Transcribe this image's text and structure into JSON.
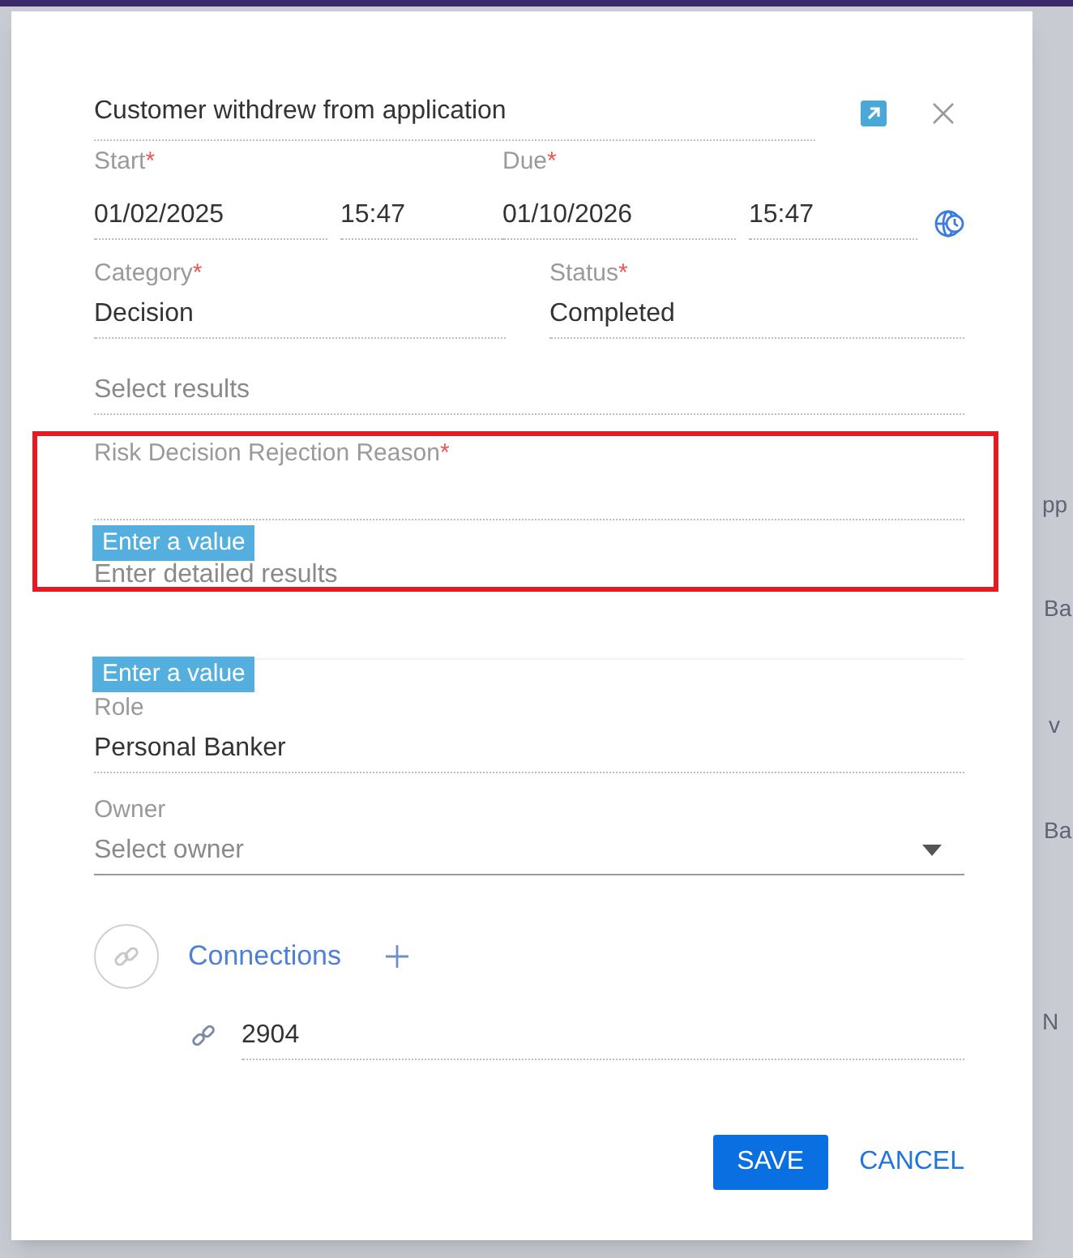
{
  "background": {
    "fragments": [
      "pp",
      "Ba",
      "v",
      "Ba",
      "N"
    ]
  },
  "title_field": {
    "value": "Customer withdrew from application"
  },
  "start": {
    "label": "Start",
    "required_mark": "*",
    "date": "01/02/2025",
    "time": "15:47"
  },
  "due": {
    "label": "Due",
    "required_mark": "*",
    "date": "01/10/2026",
    "time": "15:47"
  },
  "category": {
    "label": "Category",
    "required_mark": "*",
    "value": "Decision"
  },
  "status": {
    "label": "Status",
    "required_mark": "*",
    "value": "Completed"
  },
  "results": {
    "placeholder": "Select results"
  },
  "rejection_reason": {
    "label": "Risk Decision Rejection Reason",
    "required_mark": "*",
    "validation_message": "Enter a value"
  },
  "detailed_results": {
    "placeholder": "Enter detailed results",
    "validation_message": "Enter a value"
  },
  "role": {
    "label": "Role",
    "value": "Personal Banker"
  },
  "owner": {
    "label": "Owner",
    "placeholder": "Select owner"
  },
  "connections": {
    "label": "Connections",
    "items": [
      "2904"
    ]
  },
  "buttons": {
    "save": "SAVE",
    "cancel": "CANCEL"
  }
}
